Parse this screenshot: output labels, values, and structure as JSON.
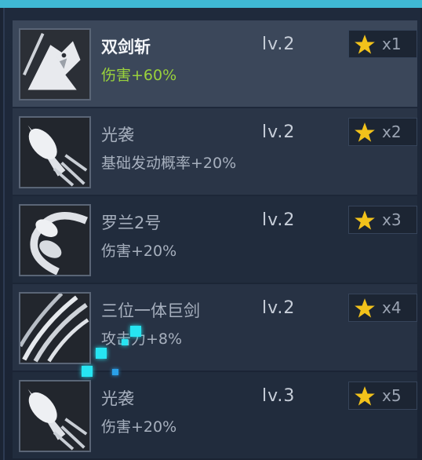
{
  "skills": [
    {
      "name": "双剑斩",
      "effect": "伤害+60%",
      "level": "lv.2",
      "multiplier": "x1",
      "icon": "wolf-icon"
    },
    {
      "name": "光袭",
      "effect": "基础发动概率+20%",
      "level": "lv.2",
      "multiplier": "x2",
      "icon": "missile-icon"
    },
    {
      "name": "罗兰2号",
      "effect": "伤害+20%",
      "level": "lv.2",
      "multiplier": "x3",
      "icon": "swirl-icon"
    },
    {
      "name": "三位一体巨剑",
      "effect": "攻击力+8%",
      "level": "lv.2",
      "multiplier": "x4",
      "icon": "slash-icon"
    },
    {
      "name": "光袭",
      "effect": "伤害+20%",
      "level": "lv.3",
      "multiplier": "x5",
      "icon": "missile-icon"
    }
  ],
  "colors": {
    "highlight_effect": "#9ad23c",
    "star": "#f2c21b",
    "accent": "#3fb8d4"
  }
}
